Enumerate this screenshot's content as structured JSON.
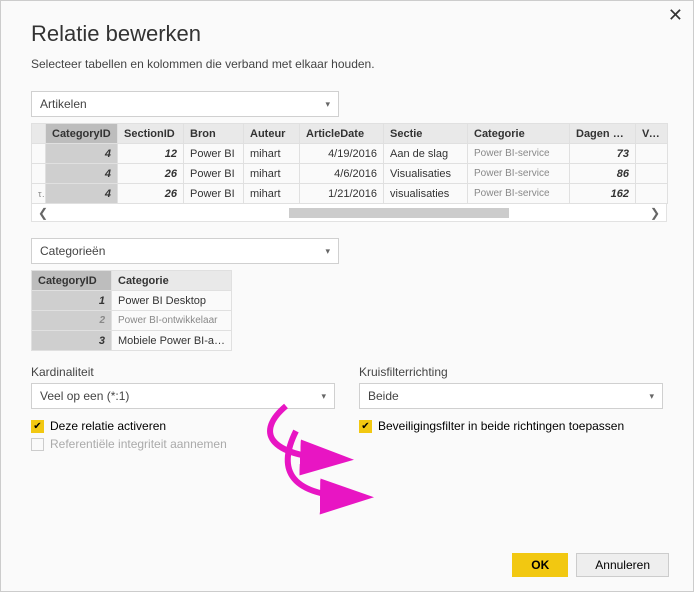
{
  "dialog": {
    "title": "Relatie bewerken",
    "subtitle": "Selecteer tabellen en kolommen die verband met elkaar houden.",
    "close_label": "✕"
  },
  "table1_select": "Artikelen",
  "table1": {
    "headers": [
      "CategoryID",
      "SectionID",
      "Bron",
      "Auteur",
      "ArticleDate",
      "Sectie",
      "Categorie",
      "Dagen oud",
      "Vers"
    ],
    "rows": [
      {
        "gut": "",
        "cells": [
          "4",
          "12",
          "Power BI",
          "mihart",
          "4/19/2016",
          "Aan de slag",
          "Power BI-service",
          "73",
          ""
        ]
      },
      {
        "gut": "",
        "cells": [
          "4",
          "26",
          "Power BI",
          "mihart",
          "4/6/2016",
          "Visualisaties",
          "Power BI-service",
          "86",
          ""
        ]
      },
      {
        "gut": "τ-i",
        "cells": [
          "4",
          "26",
          "Power BI",
          "mihart",
          "1/21/2016",
          "visualisaties",
          "Power BI-service",
          "162",
          ""
        ]
      }
    ]
  },
  "table2_select": "Categorieën",
  "table2": {
    "headers": [
      "CategoryID",
      "Categorie"
    ],
    "rows": [
      {
        "cells": [
          "1",
          "Power BI Desktop"
        ]
      },
      {
        "cells": [
          "2",
          "Power BI-ontwikkelaar"
        ],
        "light": true
      },
      {
        "cells": [
          "3",
          "Mobiele Power BI-app"
        ]
      }
    ]
  },
  "form": {
    "cardinality_label": "Kardinaliteit",
    "cardinality_value": "Veel op een (*:1)",
    "crossfilter_label": "Kruisfilterrichting",
    "crossfilter_value": "Beide",
    "activate_label": "Deze relatie activeren",
    "integrity_label": "Referentiële integriteit aannemen",
    "bothdir_label": "Beveiligingsfilter in beide richtingen toepassen"
  },
  "buttons": {
    "ok": "OK",
    "cancel": "Annuleren"
  }
}
